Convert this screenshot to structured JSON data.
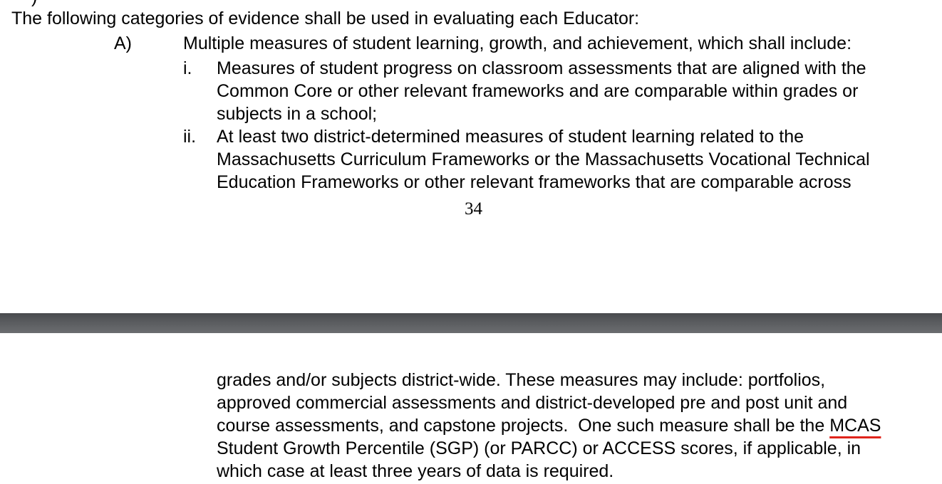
{
  "page_top": {
    "stub": ")",
    "intro": "The following categories of evidence shall be used in evaluating each Educator:",
    "item_a": {
      "marker": "A)",
      "text": "Multiple measures of student learning, growth, and achievement, which shall include:"
    },
    "item_i": {
      "marker": "i.",
      "lines": [
        "Measures of student progress on classroom assessments that are aligned with the",
        "Common Core or other relevant frameworks and are comparable within grades or",
        "subjects in a school;"
      ]
    },
    "item_ii": {
      "marker": "ii.",
      "lines": [
        "At least two district-determined measures of student learning related to the",
        "Massachusetts Curriculum Frameworks or the Massachusetts Vocational Technical",
        "Education Frameworks or other relevant frameworks that are comparable across"
      ]
    },
    "page_number": "34"
  },
  "page_bottom": {
    "lines": [
      "grades and/or subjects district-wide.  These measures may include:  portfolios,",
      "approved commercial assessments and district-developed pre and post unit and"
    ],
    "line3_before": "course assessments, and capstone projects.  One such measure shall be the ",
    "line3_flagged": "MCAS",
    "lines_after": [
      "Student Growth Percentile (SGP) (or PARCC) or ACCESS scores, if applicable, in",
      "which case at least three years of data is required."
    ]
  }
}
